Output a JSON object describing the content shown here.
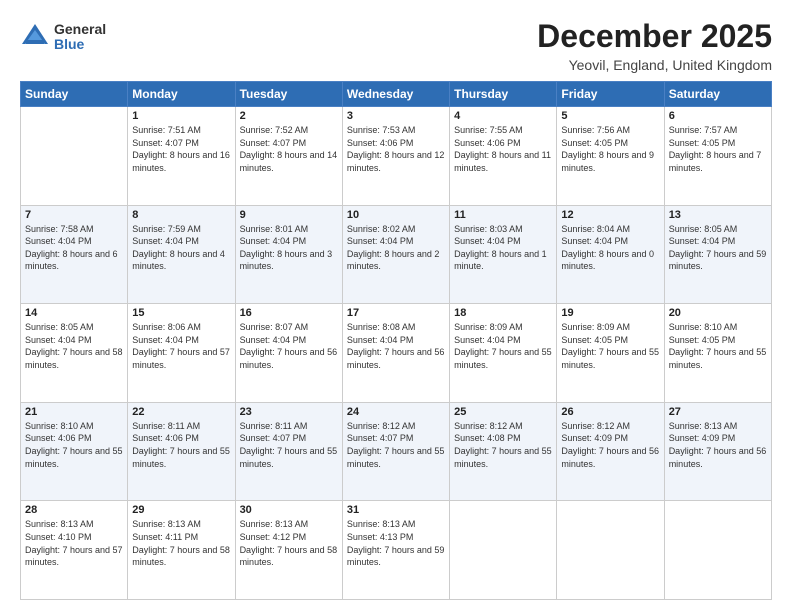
{
  "logo": {
    "general": "General",
    "blue": "Blue"
  },
  "title": "December 2025",
  "subtitle": "Yeovil, England, United Kingdom",
  "headers": [
    "Sunday",
    "Monday",
    "Tuesday",
    "Wednesday",
    "Thursday",
    "Friday",
    "Saturday"
  ],
  "weeks": [
    [
      {
        "day": "",
        "sunrise": "",
        "sunset": "",
        "daylight": ""
      },
      {
        "day": "1",
        "sunrise": "Sunrise: 7:51 AM",
        "sunset": "Sunset: 4:07 PM",
        "daylight": "Daylight: 8 hours and 16 minutes."
      },
      {
        "day": "2",
        "sunrise": "Sunrise: 7:52 AM",
        "sunset": "Sunset: 4:07 PM",
        "daylight": "Daylight: 8 hours and 14 minutes."
      },
      {
        "day": "3",
        "sunrise": "Sunrise: 7:53 AM",
        "sunset": "Sunset: 4:06 PM",
        "daylight": "Daylight: 8 hours and 12 minutes."
      },
      {
        "day": "4",
        "sunrise": "Sunrise: 7:55 AM",
        "sunset": "Sunset: 4:06 PM",
        "daylight": "Daylight: 8 hours and 11 minutes."
      },
      {
        "day": "5",
        "sunrise": "Sunrise: 7:56 AM",
        "sunset": "Sunset: 4:05 PM",
        "daylight": "Daylight: 8 hours and 9 minutes."
      },
      {
        "day": "6",
        "sunrise": "Sunrise: 7:57 AM",
        "sunset": "Sunset: 4:05 PM",
        "daylight": "Daylight: 8 hours and 7 minutes."
      }
    ],
    [
      {
        "day": "7",
        "sunrise": "Sunrise: 7:58 AM",
        "sunset": "Sunset: 4:04 PM",
        "daylight": "Daylight: 8 hours and 6 minutes."
      },
      {
        "day": "8",
        "sunrise": "Sunrise: 7:59 AM",
        "sunset": "Sunset: 4:04 PM",
        "daylight": "Daylight: 8 hours and 4 minutes."
      },
      {
        "day": "9",
        "sunrise": "Sunrise: 8:01 AM",
        "sunset": "Sunset: 4:04 PM",
        "daylight": "Daylight: 8 hours and 3 minutes."
      },
      {
        "day": "10",
        "sunrise": "Sunrise: 8:02 AM",
        "sunset": "Sunset: 4:04 PM",
        "daylight": "Daylight: 8 hours and 2 minutes."
      },
      {
        "day": "11",
        "sunrise": "Sunrise: 8:03 AM",
        "sunset": "Sunset: 4:04 PM",
        "daylight": "Daylight: 8 hours and 1 minute."
      },
      {
        "day": "12",
        "sunrise": "Sunrise: 8:04 AM",
        "sunset": "Sunset: 4:04 PM",
        "daylight": "Daylight: 8 hours and 0 minutes."
      },
      {
        "day": "13",
        "sunrise": "Sunrise: 8:05 AM",
        "sunset": "Sunset: 4:04 PM",
        "daylight": "Daylight: 7 hours and 59 minutes."
      }
    ],
    [
      {
        "day": "14",
        "sunrise": "Sunrise: 8:05 AM",
        "sunset": "Sunset: 4:04 PM",
        "daylight": "Daylight: 7 hours and 58 minutes."
      },
      {
        "day": "15",
        "sunrise": "Sunrise: 8:06 AM",
        "sunset": "Sunset: 4:04 PM",
        "daylight": "Daylight: 7 hours and 57 minutes."
      },
      {
        "day": "16",
        "sunrise": "Sunrise: 8:07 AM",
        "sunset": "Sunset: 4:04 PM",
        "daylight": "Daylight: 7 hours and 56 minutes."
      },
      {
        "day": "17",
        "sunrise": "Sunrise: 8:08 AM",
        "sunset": "Sunset: 4:04 PM",
        "daylight": "Daylight: 7 hours and 56 minutes."
      },
      {
        "day": "18",
        "sunrise": "Sunrise: 8:09 AM",
        "sunset": "Sunset: 4:04 PM",
        "daylight": "Daylight: 7 hours and 55 minutes."
      },
      {
        "day": "19",
        "sunrise": "Sunrise: 8:09 AM",
        "sunset": "Sunset: 4:05 PM",
        "daylight": "Daylight: 7 hours and 55 minutes."
      },
      {
        "day": "20",
        "sunrise": "Sunrise: 8:10 AM",
        "sunset": "Sunset: 4:05 PM",
        "daylight": "Daylight: 7 hours and 55 minutes."
      }
    ],
    [
      {
        "day": "21",
        "sunrise": "Sunrise: 8:10 AM",
        "sunset": "Sunset: 4:06 PM",
        "daylight": "Daylight: 7 hours and 55 minutes."
      },
      {
        "day": "22",
        "sunrise": "Sunrise: 8:11 AM",
        "sunset": "Sunset: 4:06 PM",
        "daylight": "Daylight: 7 hours and 55 minutes."
      },
      {
        "day": "23",
        "sunrise": "Sunrise: 8:11 AM",
        "sunset": "Sunset: 4:07 PM",
        "daylight": "Daylight: 7 hours and 55 minutes."
      },
      {
        "day": "24",
        "sunrise": "Sunrise: 8:12 AM",
        "sunset": "Sunset: 4:07 PM",
        "daylight": "Daylight: 7 hours and 55 minutes."
      },
      {
        "day": "25",
        "sunrise": "Sunrise: 8:12 AM",
        "sunset": "Sunset: 4:08 PM",
        "daylight": "Daylight: 7 hours and 55 minutes."
      },
      {
        "day": "26",
        "sunrise": "Sunrise: 8:12 AM",
        "sunset": "Sunset: 4:09 PM",
        "daylight": "Daylight: 7 hours and 56 minutes."
      },
      {
        "day": "27",
        "sunrise": "Sunrise: 8:13 AM",
        "sunset": "Sunset: 4:09 PM",
        "daylight": "Daylight: 7 hours and 56 minutes."
      }
    ],
    [
      {
        "day": "28",
        "sunrise": "Sunrise: 8:13 AM",
        "sunset": "Sunset: 4:10 PM",
        "daylight": "Daylight: 7 hours and 57 minutes."
      },
      {
        "day": "29",
        "sunrise": "Sunrise: 8:13 AM",
        "sunset": "Sunset: 4:11 PM",
        "daylight": "Daylight: 7 hours and 58 minutes."
      },
      {
        "day": "30",
        "sunrise": "Sunrise: 8:13 AM",
        "sunset": "Sunset: 4:12 PM",
        "daylight": "Daylight: 7 hours and 58 minutes."
      },
      {
        "day": "31",
        "sunrise": "Sunrise: 8:13 AM",
        "sunset": "Sunset: 4:13 PM",
        "daylight": "Daylight: 7 hours and 59 minutes."
      },
      {
        "day": "",
        "sunrise": "",
        "sunset": "",
        "daylight": ""
      },
      {
        "day": "",
        "sunrise": "",
        "sunset": "",
        "daylight": ""
      },
      {
        "day": "",
        "sunrise": "",
        "sunset": "",
        "daylight": ""
      }
    ]
  ]
}
